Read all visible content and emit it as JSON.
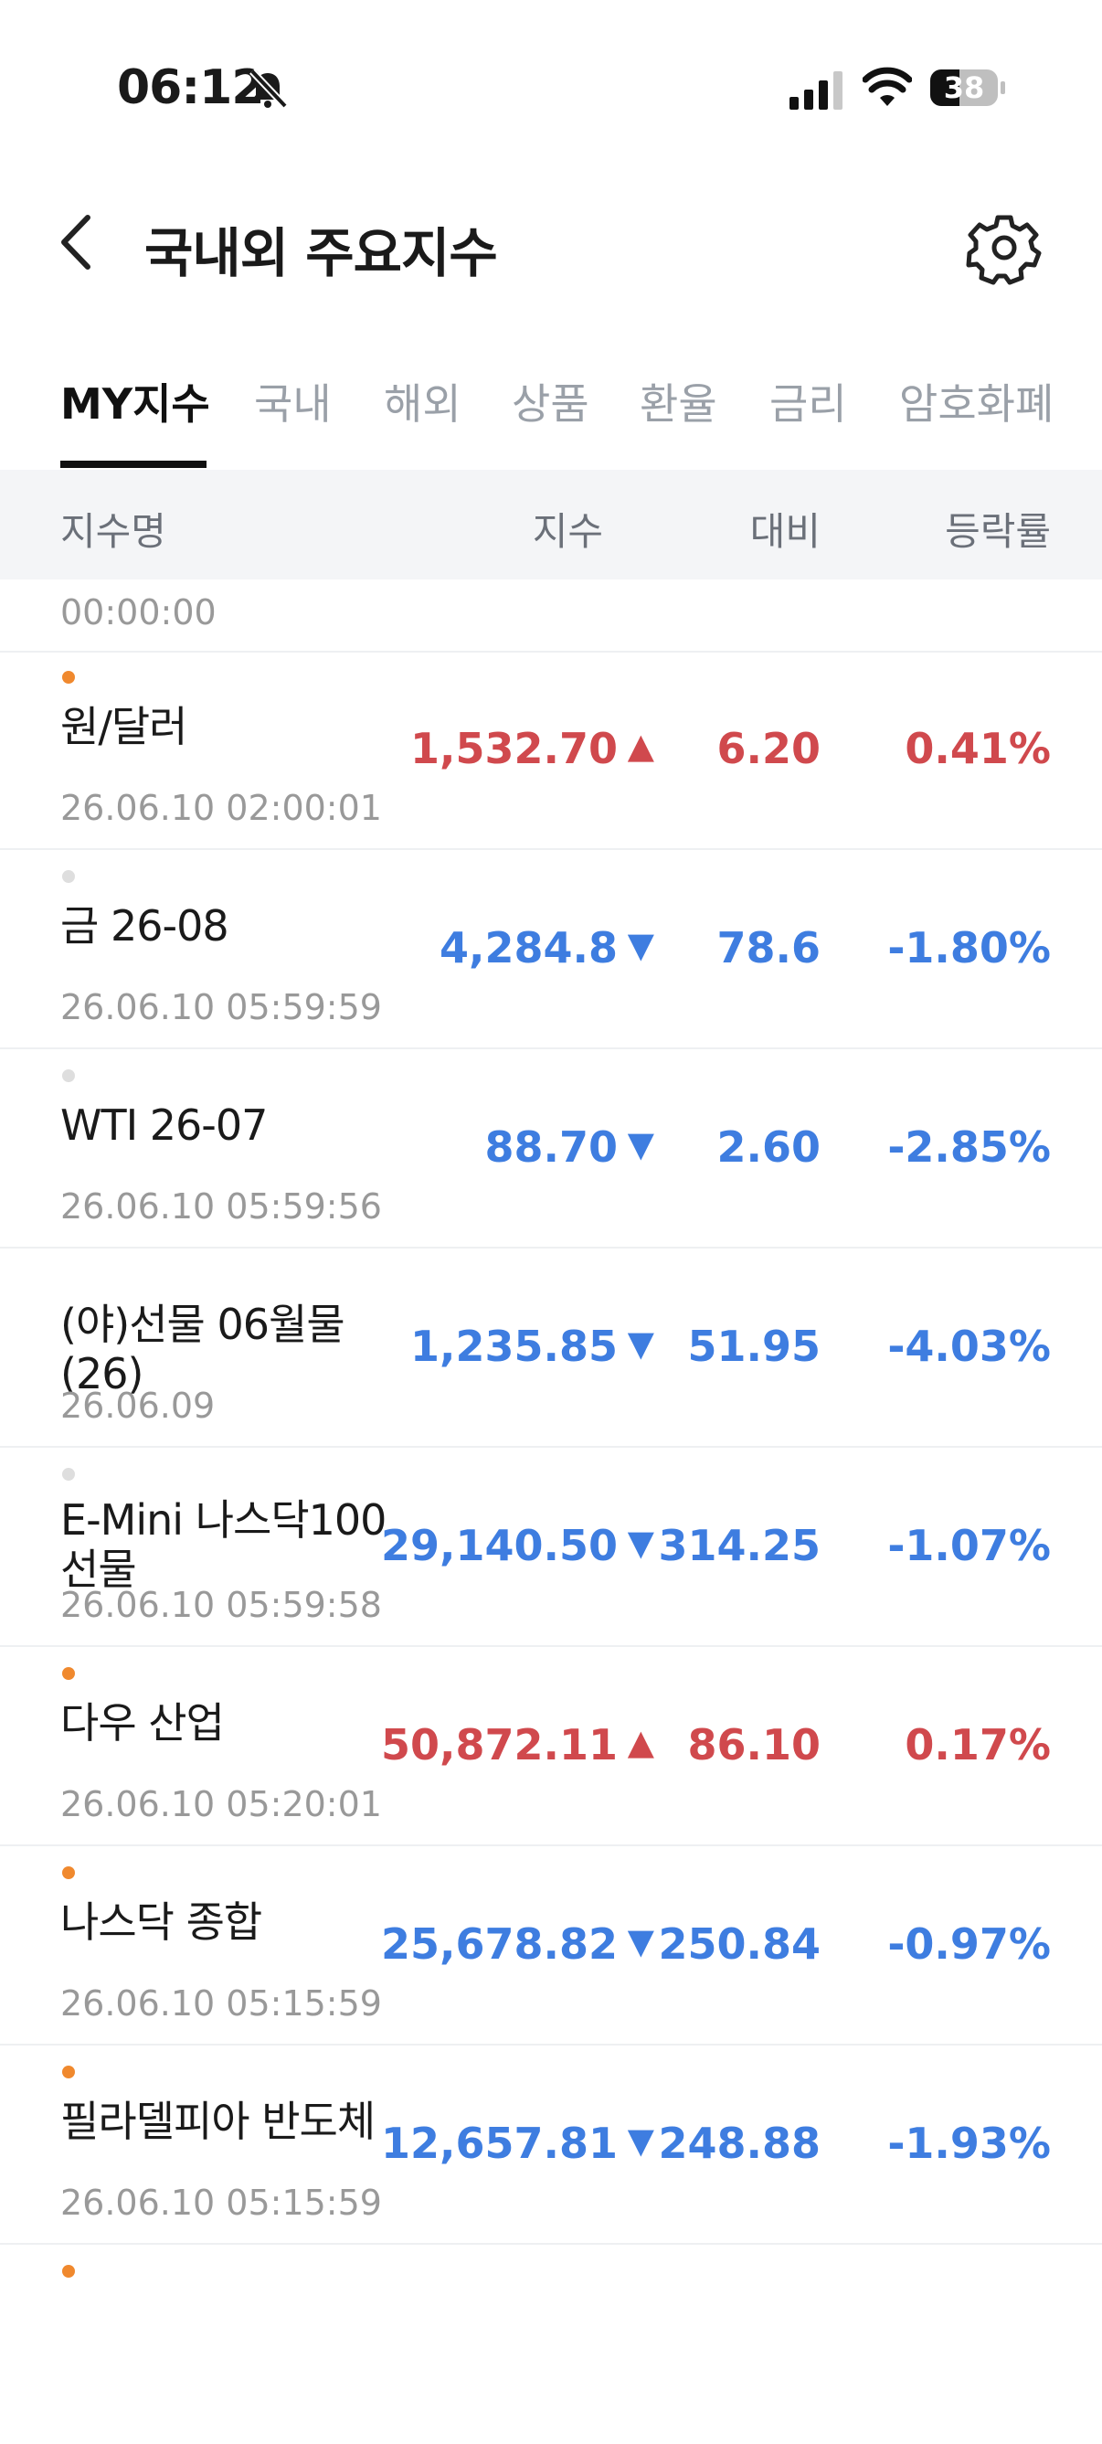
{
  "status_bar": {
    "time": "06:12",
    "battery": "38"
  },
  "header": {
    "title": "국내외 주요지수"
  },
  "tabs": [
    {
      "label": "MY지수",
      "active": true
    },
    {
      "label": "국내",
      "active": false
    },
    {
      "label": "해외",
      "active": false
    },
    {
      "label": "상품",
      "active": false
    },
    {
      "label": "환율",
      "active": false
    },
    {
      "label": "금리",
      "active": false
    },
    {
      "label": "암호화폐",
      "active": false
    }
  ],
  "columns": {
    "name": "지수명",
    "index": "지수",
    "change": "대비",
    "rate": "등락률"
  },
  "first_timestamp": "00:00:00",
  "colors": {
    "up": "#d0494d",
    "down": "#3e7de0",
    "dot_live": "#f0892e",
    "dot_closed": "#dedede"
  },
  "rows": [
    {
      "name": "원/달러",
      "timestamp": "26.06.10 02:00:01",
      "price": "1,532.70",
      "arrow": "▲",
      "change": "6.20",
      "rate": "0.41%",
      "direction": "up",
      "dot": "live"
    },
    {
      "name": "금 26-08",
      "timestamp": "26.06.10 05:59:59",
      "price": "4,284.8",
      "arrow": "▼",
      "change": "78.6",
      "rate": "-1.80%",
      "direction": "down",
      "dot": "closed"
    },
    {
      "name": "WTI 26-07",
      "timestamp": "26.06.10 05:59:56",
      "price": "88.70",
      "arrow": "▼",
      "change": "2.60",
      "rate": "-2.85%",
      "direction": "down",
      "dot": "closed"
    },
    {
      "name": "(야)선물 06월물(26)",
      "timestamp": "26.06.09",
      "price": "1,235.85",
      "arrow": "▼",
      "change": "51.95",
      "rate": "-4.03%",
      "direction": "down",
      "dot": "none"
    },
    {
      "name": "E-Mini 나스닥100 선물",
      "timestamp": "26.06.10 05:59:58",
      "price": "29,140.50",
      "arrow": "▼",
      "change": "314.25",
      "rate": "-1.07%",
      "direction": "down",
      "dot": "closed"
    },
    {
      "name": "다우 산업",
      "timestamp": "26.06.10 05:20:01",
      "price": "50,872.11",
      "arrow": "▲",
      "change": "86.10",
      "rate": "0.17%",
      "direction": "up",
      "dot": "live"
    },
    {
      "name": "나스닥 종합",
      "timestamp": "26.06.10 05:15:59",
      "price": "25,678.82",
      "arrow": "▼",
      "change": "250.84",
      "rate": "-0.97%",
      "direction": "down",
      "dot": "live"
    },
    {
      "name": "필라델피아 반도체",
      "timestamp": "26.06.10 05:15:59",
      "price": "12,657.81",
      "arrow": "▼",
      "change": "248.88",
      "rate": "-1.93%",
      "direction": "down",
      "dot": "live"
    },
    {
      "name": "",
      "timestamp": "",
      "price": "",
      "arrow": "",
      "change": "",
      "rate": "",
      "direction": "up",
      "dot": "live"
    }
  ]
}
